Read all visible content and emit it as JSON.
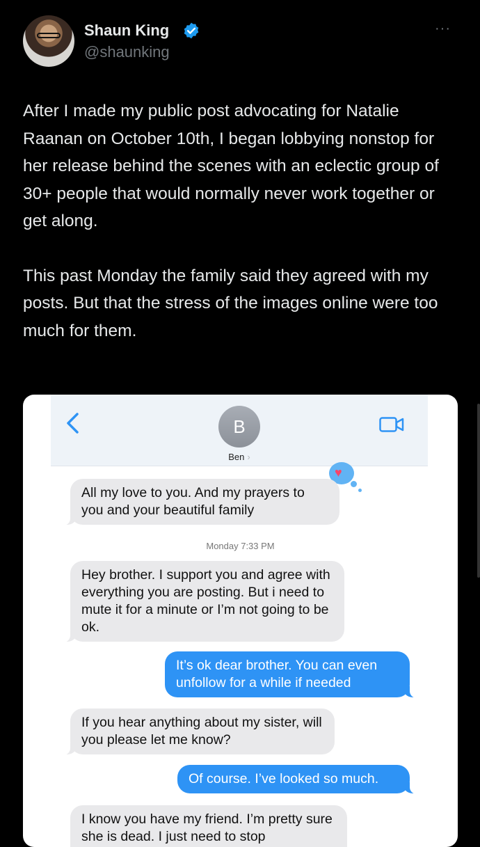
{
  "tweet": {
    "author_name": "Shaun King",
    "author_handle": "@shaunking",
    "more": "···",
    "paragraphs": [
      "After I made my public post advocating for Natalie Raanan on October 10th, I began lobbying nonstop for her release behind the scenes with an eclectic group of 30+ people that would normally never work together or get along.",
      "This past Monday the family said they agreed with my posts. But that the stress of the images online were too much for them."
    ]
  },
  "imessage": {
    "contact_initial": "B",
    "contact_name": "Ben",
    "contact_chevron": "›",
    "timestamp": "Monday 7:33 PM",
    "reaction": "♥",
    "messages": [
      {
        "side": "in",
        "text": "All my love to you. And my prayers to you and your beautiful family"
      },
      {
        "side": "in",
        "text": "Hey brother. I support you and agree with everything you are posting. But i need to mute it for a minute or I’m not going to be ok."
      },
      {
        "side": "out",
        "text": "It’s ok dear brother. You can even unfollow for a while if needed"
      },
      {
        "side": "in",
        "text": "If you hear anything about my sister, will you please let me know?"
      },
      {
        "side": "out",
        "text": "Of course. I’ve looked so much."
      },
      {
        "side": "in",
        "text": "I know you have my friend. I’m pretty sure she is dead. I just need to stop"
      }
    ]
  },
  "colors": {
    "background": "#000000",
    "text": "#e7e9ea",
    "muted": "#71767b",
    "verified": "#1d9bf0",
    "imessage_blue": "#2e93f5",
    "imessage_gray": "#e9e9eb"
  }
}
